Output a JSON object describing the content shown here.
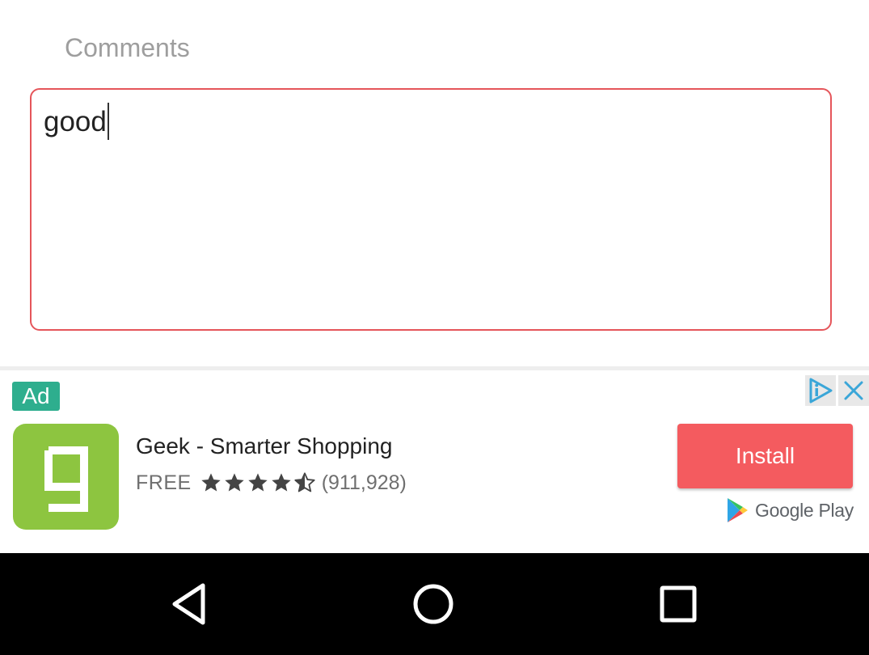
{
  "form": {
    "comments_label": "Comments",
    "comments_value": "good"
  },
  "ad": {
    "badge": "Ad",
    "app_name": "Geek - Smarter Shopping",
    "price": "FREE",
    "rating": 4.5,
    "rating_count": "(911,928)",
    "install_label": "Install",
    "store_label": "Google Play",
    "icons": [
      "adchoices-icon",
      "close-icon",
      "geek-app-icon",
      "star-icon",
      "google-play-icon"
    ]
  },
  "navbar": {
    "icons": [
      "back-icon",
      "home-icon",
      "recents-icon"
    ]
  },
  "colors": {
    "input_border": "#e5555a",
    "ad_badge": "#2eae8e",
    "app_icon_bg": "#8dc540",
    "install_button": "#f45b5f",
    "navbar_bg": "#000000"
  }
}
